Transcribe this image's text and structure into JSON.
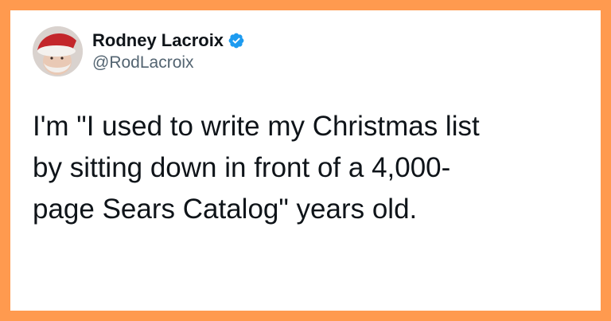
{
  "frame": {
    "border_color": "#ff9a4f",
    "background": "#ffffff"
  },
  "author": {
    "display_name": "Rodney Lacroix",
    "handle": "@RodLacroix",
    "verified": true,
    "verified_icon": "verified-badge-icon",
    "verified_color": "#1d9bf0",
    "avatar_icon": "avatar-santa-hat"
  },
  "tweet": {
    "text": "I'm \"I used to write my Christmas list\nby sitting down in front of a 4,000-\npage Sears Catalog\" years old."
  }
}
